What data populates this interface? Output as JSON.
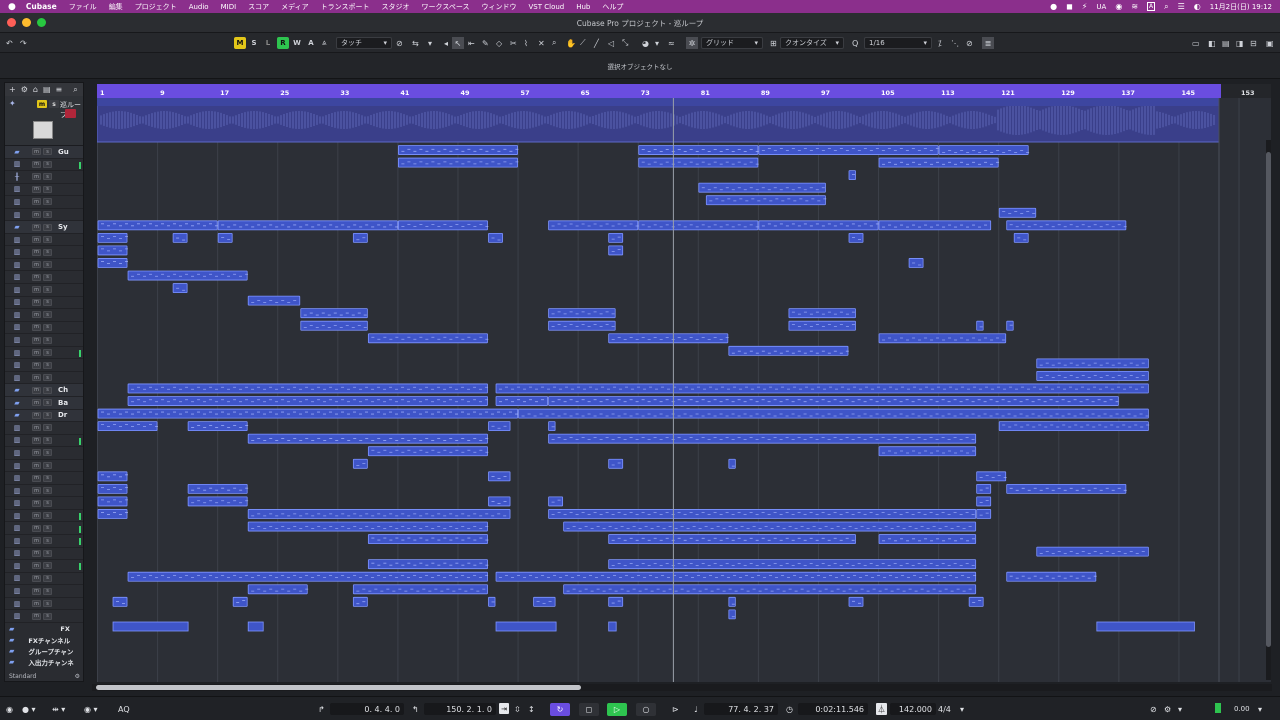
{
  "menubar": {
    "app_name": "Cubase",
    "items": [
      "ファイル",
      "編集",
      "プロジェクト",
      "Audio",
      "MIDI",
      "スコア",
      "メディア",
      "トランスポート",
      "スタジオ",
      "ワークスペース",
      "ウィンドウ",
      "VST Cloud",
      "Hub",
      "ヘルプ"
    ],
    "input_label": "UA",
    "input_mode": "A",
    "datetime": "11月2日(日) 19:12"
  },
  "window": {
    "title": "Cubase Pro プロジェクト - 巡ループ",
    "colors": {
      "close": "#ff5f57",
      "min": "#febc2e",
      "max": "#28c840"
    }
  },
  "toolbar": {
    "buttons": {
      "m": "M",
      "s": "S",
      "l": "L",
      "r": "R",
      "w": "W",
      "a": "A"
    },
    "automation_mode": "タッチ",
    "grid_label": "グリッド",
    "quantize_label": "クオンタイズ",
    "quantize_value": "1/16"
  },
  "info_line": {
    "message": "選択オブジェクトなし"
  },
  "tracklist": {
    "marker_label": "巡ループ",
    "marker_m": "m",
    "marker_s": "s",
    "tracks": [
      {
        "type": "folder",
        "name": "Gu",
        "green": false
      },
      {
        "type": "midi",
        "name": "",
        "green": true
      },
      {
        "type": "audio",
        "name": "",
        "green": false
      },
      {
        "type": "midi",
        "name": "",
        "green": false
      },
      {
        "type": "midi",
        "name": "",
        "green": false
      },
      {
        "type": "midi",
        "name": "",
        "green": false
      },
      {
        "type": "folder",
        "name": "Sy",
        "green": false
      },
      {
        "type": "midi",
        "name": "",
        "green": false
      },
      {
        "type": "midi",
        "name": "",
        "green": false
      },
      {
        "type": "midi",
        "name": "",
        "green": false
      },
      {
        "type": "midi",
        "name": "",
        "green": false
      },
      {
        "type": "midi",
        "name": "",
        "green": false
      },
      {
        "type": "midi",
        "name": "",
        "green": false
      },
      {
        "type": "midi",
        "name": "",
        "green": false
      },
      {
        "type": "midi",
        "name": "",
        "green": false
      },
      {
        "type": "midi",
        "name": "",
        "green": false
      },
      {
        "type": "midi",
        "name": "",
        "green": true
      },
      {
        "type": "midi",
        "name": "",
        "green": false
      },
      {
        "type": "midi",
        "name": "",
        "green": false
      },
      {
        "type": "folder",
        "name": "Ch",
        "green": false
      },
      {
        "type": "folder",
        "name": "Ba",
        "green": false
      },
      {
        "type": "folder",
        "name": "Dr",
        "green": false
      },
      {
        "type": "midi",
        "name": "",
        "green": false
      },
      {
        "type": "midi",
        "name": "",
        "green": true
      },
      {
        "type": "midi",
        "name": "",
        "green": false
      },
      {
        "type": "midi",
        "name": "",
        "green": false
      },
      {
        "type": "midi",
        "name": "",
        "green": false
      },
      {
        "type": "midi",
        "name": "",
        "green": false
      },
      {
        "type": "midi",
        "name": "",
        "green": false
      },
      {
        "type": "midi",
        "name": "",
        "green": true
      },
      {
        "type": "midi",
        "name": "",
        "green": true
      },
      {
        "type": "midi",
        "name": "",
        "green": true
      },
      {
        "type": "midi",
        "name": "",
        "green": false
      },
      {
        "type": "midi",
        "name": "",
        "green": true
      },
      {
        "type": "midi",
        "name": "",
        "green": false
      },
      {
        "type": "midi",
        "name": "",
        "green": false
      },
      {
        "type": "midi",
        "name": "",
        "green": false
      },
      {
        "type": "midi",
        "name": "",
        "green": false
      }
    ],
    "bottom_folders": [
      "FX",
      "FXチャンネル",
      "グループチャン",
      "入出力チャンネ"
    ],
    "footer": "Standard"
  },
  "ruler": {
    "ticks": [
      "1",
      "9",
      "17",
      "25",
      "33",
      "41",
      "49",
      "57",
      "65",
      "73",
      "81",
      "89",
      "97",
      "105",
      "113",
      "121",
      "129",
      "137",
      "145",
      "153"
    ]
  },
  "transport": {
    "left_locator": "0. 4. 4.   0",
    "right_locator": "150. 2. 1.   0",
    "position_bars": "77. 4. 2.  37",
    "position_time": "0:02:11.546",
    "tempo": "142.000",
    "signature": "4/4",
    "aq": "AQ",
    "level": "0.00"
  },
  "theme": {
    "ruler": "#6a4de0",
    "event_fill": "#3f55c8",
    "event_border": "#7f95ff",
    "playhead": "#9aa0aa"
  }
}
